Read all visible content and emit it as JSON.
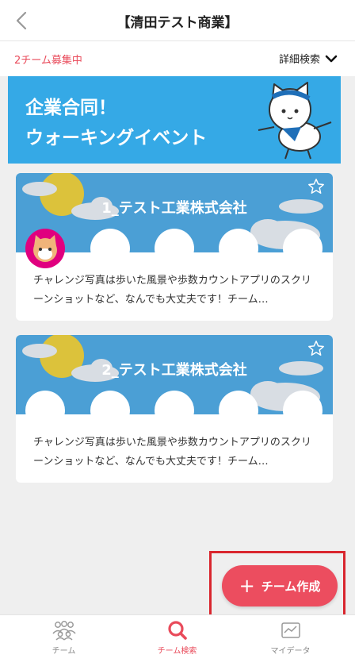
{
  "header": {
    "title": "【清田テスト商業】"
  },
  "subbar": {
    "recruit_text": "2チーム募集中",
    "detail_search_label": "詳細検索"
  },
  "banner": {
    "line1": "企業合同！",
    "line2": "ウォーキングイベント"
  },
  "teams": [
    {
      "name": "1_テスト工業株式会社",
      "description": "チャレンジ写真は歩いた風景や歩数カウントアプリのスクリーンショットなど、なんでも大丈夫です！チーム…"
    },
    {
      "name": "2_テスト工業株式会社",
      "description": "チャレンジ写真は歩いた風景や歩数カウントアプリのスクリーンショットなど、なんでも大丈夫です！チーム…"
    }
  ],
  "fab": {
    "label": "チーム作成"
  },
  "tabbar": {
    "items": [
      {
        "label": "チーム"
      },
      {
        "label": "チーム検索"
      },
      {
        "label": "マイデータ"
      }
    ]
  },
  "colors": {
    "accent": "#ec4d5f",
    "banner": "#35a9e6",
    "card_sky": "#4b9fd5",
    "highlight": "#d9262e"
  }
}
